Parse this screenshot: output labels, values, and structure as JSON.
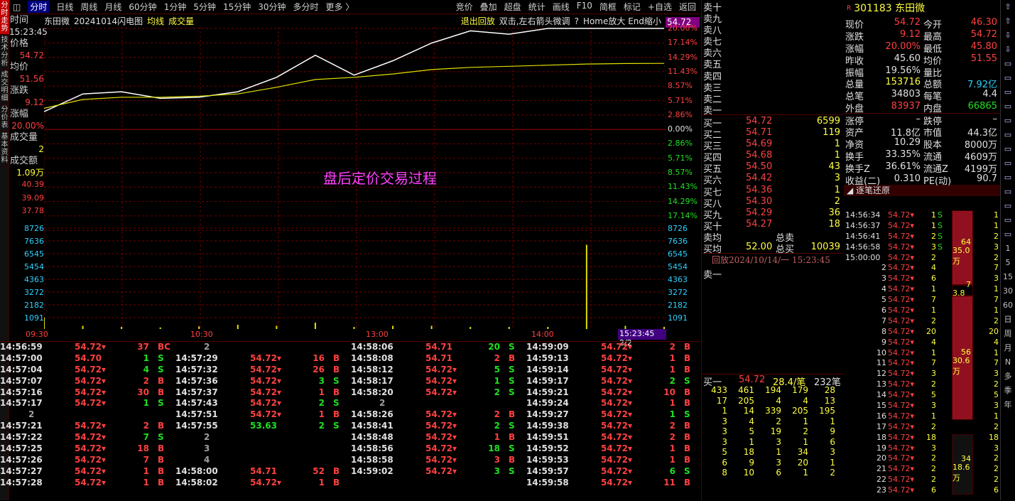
{
  "vtabs": [
    {
      "label": "分时走势",
      "on": true
    },
    {
      "label": "技术分析",
      "on": false
    },
    {
      "label": "成交明细",
      "on": false
    },
    {
      "label": "分价表",
      "on": false
    },
    {
      "label": "基本资料",
      "on": false
    }
  ],
  "topbar": {
    "items": [
      "分时",
      "日线",
      "周线",
      "月线",
      "60分钟",
      "1分钟",
      "5分钟",
      "15分钟",
      "30分钟",
      "多分时",
      "更多 〉"
    ],
    "right": [
      "竞价",
      "叠加",
      "超盘",
      "统计",
      "画线",
      "F10",
      "简框",
      "标记",
      "+自选",
      "返回"
    ]
  },
  "ctitle": {
    "name": "东田微",
    "desc": "20241014闪电图",
    "avg": "均线",
    "vol": "成交量",
    "exit": "退出回放",
    "hint1": "双击,左右箭头微调",
    "q": "?",
    "hint2": "Home放大 End缩小",
    "price": "54.72"
  },
  "linfo": {
    "time_l": "时间",
    "time_v": "15:23:45",
    "price_l": "价格",
    "price_v": "54.72",
    "avg_l": "均价",
    "avg_v": "51.56",
    "chg_l": "涨跌",
    "chg_v": "9.12",
    "pct_l": "涨幅",
    "pct_v": "20.00%",
    "vol_l": "成交量",
    "vol_v": "2",
    "amt_l": "成交额",
    "amt_v": "1.09万"
  },
  "yleft_price": [
    "40.39",
    "39.09",
    "37.78"
  ],
  "yleft_vol": [
    "8726",
    "7636",
    "6545",
    "5454",
    "4363",
    "3272",
    "2182",
    "1091"
  ],
  "yright_pct": [
    "20.00%",
    "17.14%",
    "14.29%",
    "11.43%",
    "8.57%",
    "5.71%",
    "2.86%",
    "0.00%",
    "2.86%",
    "5.71%",
    "8.57%",
    "11.43%",
    "14.29%",
    "17.14%"
  ],
  "yright_vol": [
    "8726",
    "7636",
    "6545",
    "5454",
    "4363",
    "3272",
    "2182",
    "1091"
  ],
  "xlabels": [
    "09:30",
    "10:30",
    "13:00",
    "14:00"
  ],
  "cursor_time": "15:23:45 2/2",
  "center_text": "盘后定价交易过程",
  "colors": {
    "up": "#ff4040",
    "down": "#20e020",
    "avg": "#e0e000",
    "price": "#ffffff",
    "label": "#ff40ff"
  },
  "chart_data": {
    "type": "line",
    "title": "东田微 20241014闪电图",
    "prev_close": 45.6,
    "ylim": [
      36.48,
      54.72
    ],
    "x": [
      "09:30",
      "09:45",
      "10:00",
      "10:15",
      "10:25",
      "10:35",
      "10:45",
      "10:55",
      "11:10",
      "11:25",
      "13:00",
      "13:10",
      "13:30",
      "13:50",
      "14:10",
      "14:30",
      "15:00"
    ],
    "series": [
      {
        "name": "价格",
        "values": [
          47.2,
          48.8,
          49.0,
          48.4,
          48.5,
          49.0,
          50.3,
          52.3,
          50.5,
          51.8,
          53.4,
          54.5,
          54.2,
          54.72,
          54.72,
          54.72,
          54.72
        ]
      },
      {
        "name": "均价",
        "values": [
          47.5,
          48.3,
          48.5,
          48.5,
          48.6,
          48.8,
          49.4,
          50.1,
          50.3,
          50.6,
          51.0,
          51.2,
          51.3,
          51.4,
          51.5,
          51.55,
          51.56
        ]
      }
    ],
    "volume": [
      1091,
      300,
      200,
      150,
      250,
      400,
      300,
      600,
      200,
      300,
      300,
      200,
      200,
      200,
      7900,
      300,
      200
    ]
  },
  "ticks": [
    [
      [
        "14:56:59",
        "54.72",
        "37",
        "BC"
      ],
      [
        "14:57:00",
        "54.70",
        "1",
        "S"
      ],
      [
        "14:57:04",
        "54.72",
        "4",
        "S"
      ],
      [
        "14:57:07",
        "54.72",
        "2",
        "B"
      ],
      [
        "14:57:16",
        "54.72",
        "30",
        "B"
      ],
      [
        "14:57:17",
        "54.72",
        "1",
        "S"
      ],
      [
        "",
        "2",
        "",
        ""
      ],
      [
        "14:57:21",
        "54.72",
        "2",
        "B"
      ],
      [
        "14:57:22",
        "54.72",
        "7",
        "S"
      ],
      [
        "14:57:25",
        "54.72",
        "18",
        "B"
      ],
      [
        "14:57:26",
        "54.72",
        "7",
        "B"
      ],
      [
        "14:57:27",
        "54.72",
        "1",
        "B"
      ],
      [
        "14:57:28",
        "54.72",
        "1",
        "B"
      ]
    ],
    [
      [
        "",
        "2",
        "",
        ""
      ],
      [
        "14:57:29",
        "54.72",
        "16",
        "B"
      ],
      [
        "14:57:32",
        "54.72",
        "26",
        "B"
      ],
      [
        "14:57:36",
        "54.72",
        "3",
        "S"
      ],
      [
        "14:57:37",
        "54.72",
        "1",
        "B"
      ],
      [
        "14:57:43",
        "54.72",
        "2",
        "S"
      ],
      [
        "14:57:51",
        "54.72",
        "1",
        "B"
      ],
      [
        "14:57:55",
        "53.63",
        "2",
        "S"
      ],
      [
        "",
        "2",
        "",
        ""
      ],
      [
        "",
        "3",
        "",
        ""
      ],
      [
        "",
        "4",
        "",
        ""
      ],
      [
        "14:58:00",
        "54.71",
        "52",
        "B"
      ],
      [
        "14:58:02",
        "54.72",
        "1",
        "B"
      ]
    ],
    [
      [
        "14:58:06",
        "54.71",
        "20",
        "S"
      ],
      [
        "14:58:08",
        "54.71",
        "2",
        "B"
      ],
      [
        "14:58:12",
        "54.72",
        "5",
        "S"
      ],
      [
        "14:58:17",
        "54.72",
        "1",
        "S"
      ],
      [
        "14:58:20",
        "54.72",
        "2",
        "S"
      ],
      [
        "",
        "2",
        "",
        ""
      ],
      [
        "14:58:26",
        "54.72",
        "2",
        "B"
      ],
      [
        "14:58:41",
        "54.72",
        "2",
        "S"
      ],
      [
        "14:58:48",
        "54.72",
        "1",
        "B"
      ],
      [
        "14:58:56",
        "54.72",
        "18",
        "S"
      ],
      [
        "14:58:58",
        "54.72",
        "3",
        "B"
      ],
      [
        "14:59:02",
        "54.72",
        "3",
        "S"
      ],
      [
        "",
        "",
        " ",
        ""
      ]
    ],
    [
      [
        "14:59:09",
        "54.72",
        "2",
        "B"
      ],
      [
        "14:59:13",
        "54.72",
        "1",
        "B"
      ],
      [
        "14:59:14",
        "54.72",
        "1",
        "B"
      ],
      [
        "14:59:17",
        "54.72",
        "2",
        "S"
      ],
      [
        "14:59:21",
        "54.72",
        "10",
        "B"
      ],
      [
        "14:59:24",
        "54.72",
        "1",
        "B"
      ],
      [
        "14:59:27",
        "54.72",
        "1",
        "S"
      ],
      [
        "14:59:38",
        "54.72",
        "2",
        "B"
      ],
      [
        "14:59:51",
        "54.72",
        "2",
        "B"
      ],
      [
        "14:59:52",
        "54.72",
        "1",
        "B"
      ],
      [
        "14:59:53",
        "54.72",
        "1",
        "B"
      ],
      [
        "14:59:57",
        "54.72",
        "6",
        "S"
      ],
      [
        "14:59:58",
        "54.72",
        "11",
        "B"
      ]
    ]
  ],
  "book": {
    "sells": [
      "卖十",
      "卖九",
      "卖八",
      "卖七",
      "卖六",
      "卖五",
      "卖四",
      "卖三",
      "卖二",
      "卖一"
    ],
    "buys": [
      [
        "买一",
        "54.72",
        "6599"
      ],
      [
        "买二",
        "54.71",
        "119"
      ],
      [
        "买三",
        "54.69",
        "1"
      ],
      [
        "买四",
        "54.68",
        "1"
      ],
      [
        "买五",
        "54.50",
        "43"
      ],
      [
        "买六",
        "54.42",
        "3"
      ],
      [
        "买七",
        "54.36",
        "1"
      ],
      [
        "买八",
        "54.30",
        "2"
      ],
      [
        "买九",
        "54.29",
        "36"
      ],
      [
        "买十",
        "54.27",
        "18"
      ]
    ],
    "avg_l": "卖均",
    "avg_b": "买均",
    "avg_b_v": "52.00",
    "tot_s": "总卖",
    "tot_b": "总买",
    "tot_b_v": "10039",
    "replay": "回放2024/10/14/一 15:23:45",
    "sell1": "卖一",
    "bq_l": "买一",
    "bq_p": "54.72",
    "bq_a": "28.4/笔",
    "bq_n": "232笔",
    "queue": [
      [
        "433",
        "461",
        "194",
        "179",
        "28"
      ],
      [
        "17",
        "205",
        "4",
        "4",
        "13"
      ],
      [
        "1",
        "14",
        "339",
        "205",
        "195"
      ],
      [
        "3",
        "4",
        "2",
        "1",
        "1"
      ],
      [
        "3",
        "5",
        "19",
        "2",
        "9"
      ],
      [
        "3",
        "1",
        "3",
        "1",
        "6"
      ],
      [
        "5",
        "18",
        "1",
        "34",
        "3"
      ],
      [
        "6",
        "9",
        "3",
        "20",
        "1"
      ],
      [
        "8",
        "10",
        "6",
        "1",
        "2"
      ]
    ]
  },
  "quote": {
    "code": "301183",
    "name": "东田微",
    "rows": [
      [
        "现价",
        "54.72",
        "今开",
        "46.30"
      ],
      [
        "涨跌",
        "9.12",
        "最高",
        "54.72"
      ],
      [
        "涨幅",
        "20.00%",
        "最低",
        "45.80"
      ],
      [
        "昨收",
        "45.60",
        "均价",
        "51.55"
      ],
      [
        "振幅",
        "19.56%",
        "量比",
        ""
      ],
      [
        "总量",
        "153716",
        "总额",
        "7.92亿"
      ],
      [
        "总笔",
        "34803",
        "每笔",
        "4.4"
      ],
      [
        "外盘",
        "83937",
        "内盘",
        "66865"
      ],
      [
        "涨停",
        "–",
        "跌停",
        "–"
      ],
      [
        "资产",
        "11.8亿",
        "市值",
        "44.3亿"
      ],
      [
        "净资",
        "10.29",
        "股本",
        "8000万"
      ],
      [
        "换手",
        "33.35%",
        "流通",
        "4609万"
      ],
      [
        "换手Z",
        "36.61%",
        "流通Z",
        "4199万"
      ],
      [
        "收益(二)",
        "0.310",
        "PE(动)",
        "90.7"
      ]
    ],
    "tick_title": "逐笔还原"
  },
  "rtick": [
    [
      "14:56:34",
      "54.72",
      "1",
      "S"
    ],
    [
      "14:56:37",
      "54.72",
      "1",
      "S"
    ],
    [
      "14:56:41",
      "54.72",
      "2",
      "S"
    ],
    [
      "14:56:58",
      "54.72",
      "3",
      "S"
    ],
    [
      "15:00:00",
      "54.72",
      "2",
      ""
    ],
    [
      "2",
      "54.72",
      "4",
      ""
    ],
    [
      "3",
      "54.72",
      "6",
      ""
    ],
    [
      "4",
      "54.72",
      "1",
      ""
    ],
    [
      "5",
      "54.72",
      "7",
      ""
    ],
    [
      "6",
      "54.72",
      "1",
      ""
    ],
    [
      "7",
      "54.72",
      "2",
      ""
    ],
    [
      "8",
      "54.72",
      "20",
      ""
    ],
    [
      "9",
      "54.72",
      "4",
      ""
    ],
    [
      "10",
      "54.72",
      "1",
      ""
    ],
    [
      "11",
      "54.72",
      "7",
      ""
    ],
    [
      "12",
      "54.72",
      "3",
      ""
    ],
    [
      "13",
      "54.72",
      "2",
      ""
    ],
    [
      "14",
      "54.72",
      "5",
      ""
    ],
    [
      "15",
      "54.72",
      "3",
      ""
    ],
    [
      "16",
      "54.72",
      "1",
      ""
    ],
    [
      "17",
      "54.72",
      "2",
      ""
    ],
    [
      "18",
      "54.72",
      "18",
      ""
    ],
    [
      "19",
      "54.72",
      "3",
      ""
    ],
    [
      "20",
      "54.72",
      "2",
      ""
    ],
    [
      "21",
      "54.72",
      "2",
      ""
    ],
    [
      "22",
      "54.72",
      "2",
      ""
    ],
    [
      "23",
      "54.72",
      "6",
      ""
    ]
  ],
  "rbars": [
    {
      "label1": "64",
      "label2": "35.0万"
    },
    {
      "label1": "7",
      "label2": "3.8万"
    },
    {
      "label1": "56",
      "label2": "30.6万"
    },
    {
      "label1": "34",
      "label2": "18.6万"
    }
  ],
  "rbar_nums": [
    "1",
    "1",
    "2",
    "3",
    "2",
    "7",
    "3",
    "1",
    "7",
    "1",
    "2",
    "20",
    "4",
    "1",
    "7",
    "3",
    "2",
    "5",
    "3",
    "1",
    "2",
    "18",
    "3",
    "2",
    "2",
    "2",
    "6"
  ],
  "rtool": [
    "⇧",
    "⇧",
    "⇩",
    "⇩",
    "▭",
    "▭",
    "▭",
    "▭",
    "▭",
    "▭",
    "▭",
    "▭",
    "▭",
    "▭",
    "▭",
    "▭",
    "▭",
    "1",
    "5",
    "15",
    "30",
    "60",
    "日",
    "周",
    "月",
    "N",
    "多",
    "季",
    "年"
  ]
}
